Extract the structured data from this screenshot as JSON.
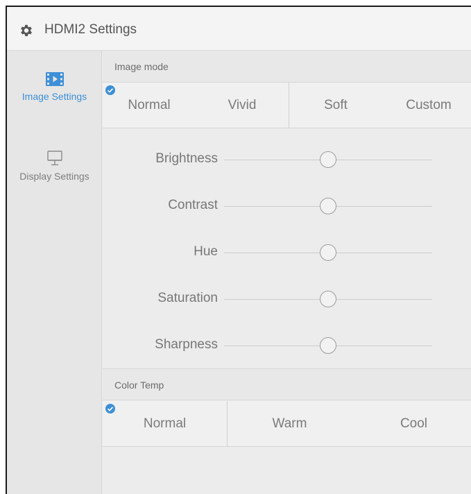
{
  "window": {
    "title": "HDMI2 Settings",
    "icon": "gear-icon"
  },
  "sidebar": {
    "items": [
      {
        "label": "Image Settings",
        "icon": "image-settings-icon",
        "active": true
      },
      {
        "label": "Display Settings",
        "icon": "monitor-icon",
        "active": false
      }
    ]
  },
  "image_mode": {
    "header": "Image mode",
    "options": [
      "Normal",
      "Vivid",
      "Soft",
      "Custom"
    ],
    "selected": "Normal"
  },
  "sliders": [
    {
      "label": "Brightness",
      "value_fraction": 0.5
    },
    {
      "label": "Contrast",
      "value_fraction": 0.5
    },
    {
      "label": "Hue",
      "value_fraction": 0.5
    },
    {
      "label": "Saturation",
      "value_fraction": 0.5
    },
    {
      "label": "Sharpness",
      "value_fraction": 0.5
    }
  ],
  "color_temp": {
    "header": "Color Temp",
    "options": [
      "Normal",
      "Warm",
      "Cool"
    ],
    "selected": "Normal"
  },
  "colors": {
    "accent": "#3d8fd6",
    "background": "#ececec",
    "text": "#777777"
  }
}
